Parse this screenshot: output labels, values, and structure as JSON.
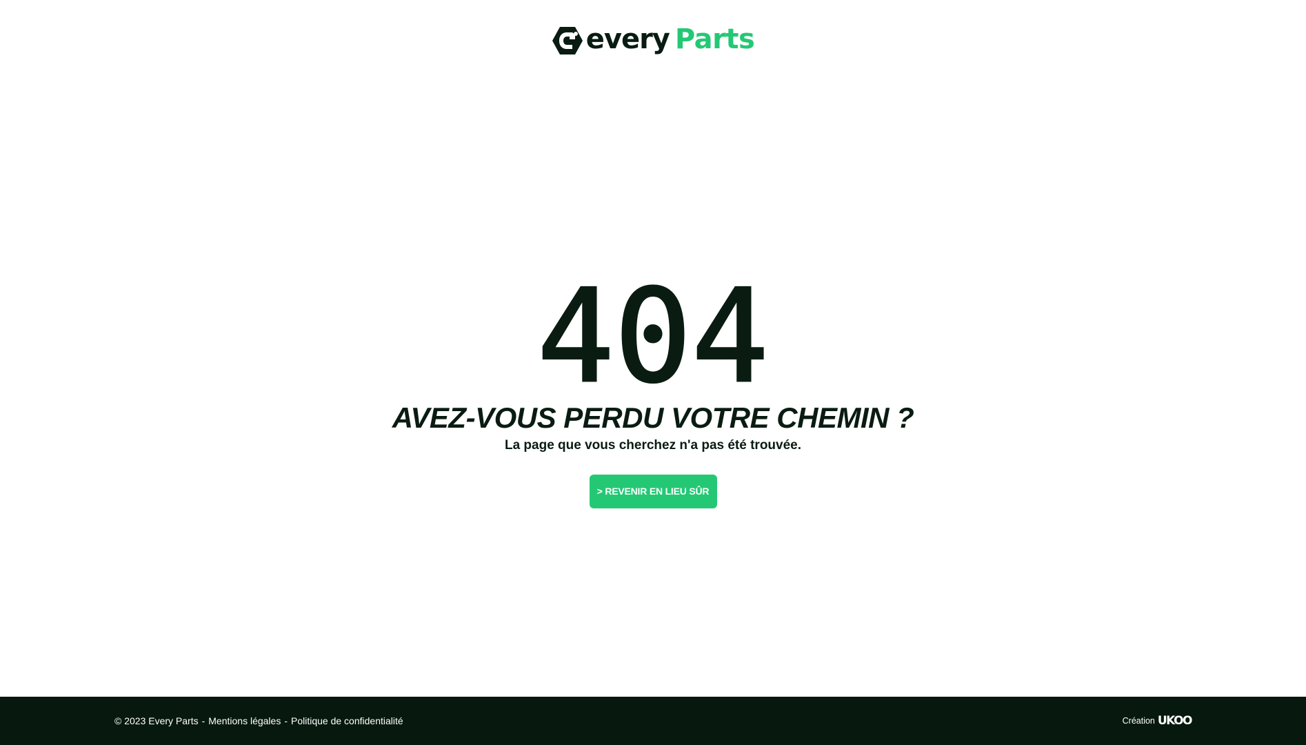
{
  "header": {
    "logo": {
      "icon": "every-parts-hex-wrench-icon",
      "word_every": "every",
      "word_parts": "Parts"
    }
  },
  "main": {
    "code": "404",
    "headline": "AVEZ-VOUS PERDU VOTRE CHEMIN ?",
    "subtext": "La page que vous cherchez n'a pas été trouvée.",
    "cta_label": "> REVENIR EN LIEU SÛR"
  },
  "footer": {
    "copyright": "© 2023 Every Parts",
    "separator": "-",
    "legal_link": "Mentions légales",
    "privacy_link": "Politique de confidentialité",
    "credit_label": "Création",
    "credit_brand": "UKOO"
  },
  "colors": {
    "brand_dark": "#0a1c12",
    "brand_green": "#24c874",
    "footer_bg": "#07190e",
    "background": "#ffffff"
  }
}
